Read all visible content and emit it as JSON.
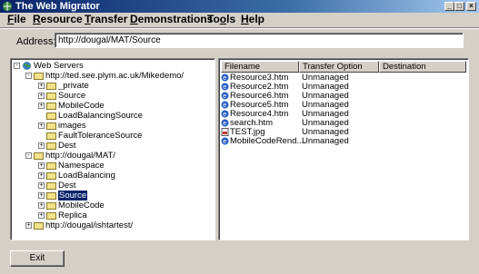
{
  "window": {
    "title": "The Web Migrator"
  },
  "menu": [
    {
      "label": "File"
    },
    {
      "label": "Resource"
    },
    {
      "label": "Transfer"
    },
    {
      "label": "Demonstrations"
    },
    {
      "label": "Tools"
    },
    {
      "label": "Help"
    }
  ],
  "address": {
    "label": "Address:",
    "value": "http://dougal/MAT/Source"
  },
  "tree": {
    "root": "Web Servers",
    "items": [
      {
        "label": "http://ted.see.plym.ac.uk/Mikedemo/",
        "expander": "-"
      },
      {
        "label": "_private",
        "expander": "+"
      },
      {
        "label": "Source",
        "expander": "+"
      },
      {
        "label": "MobileCode",
        "expander": "+"
      },
      {
        "label": "LoadBalancingSource",
        "expander": ""
      },
      {
        "label": "images",
        "expander": "+"
      },
      {
        "label": "FaultToleranceSource",
        "expander": ""
      },
      {
        "label": "Dest",
        "expander": "+"
      },
      {
        "label": "http://dougal/MAT/",
        "expander": "-"
      },
      {
        "label": "Namespace",
        "expander": "+"
      },
      {
        "label": "LoadBalancing",
        "expander": "+"
      },
      {
        "label": "Dest",
        "expander": "+"
      },
      {
        "label": "Source",
        "expander": "+",
        "selected": true
      },
      {
        "label": "MobileCode",
        "expander": "+"
      },
      {
        "label": "Replica",
        "expander": "+"
      },
      {
        "label": "http://dougal/ishtartest/",
        "expander": "+"
      }
    ]
  },
  "list": {
    "columns": [
      "Filename",
      "Transfer Option",
      "Destination"
    ],
    "rows": [
      {
        "filename": "Resource3.htm",
        "option": "Unmanaged",
        "icon": "html-file-icon"
      },
      {
        "filename": "Resource2.htm",
        "option": "Unmanaged",
        "icon": "html-file-icon"
      },
      {
        "filename": "Resource6.htm",
        "option": "Unmanaged",
        "icon": "html-file-icon"
      },
      {
        "filename": "Resource5.htm",
        "option": "Unmanaged",
        "icon": "html-file-icon"
      },
      {
        "filename": "Resource4.htm",
        "option": "Unmanaged",
        "icon": "html-file-icon"
      },
      {
        "filename": "search.htm",
        "option": "Unmanaged",
        "icon": "html-file-icon"
      },
      {
        "filename": "TEST.jpg",
        "option": "Unmanaged",
        "icon": "image-file-icon"
      },
      {
        "filename": "MobileCodeRend...",
        "option": "Unmanaged",
        "icon": "html-file-icon"
      }
    ]
  },
  "buttons": {
    "exit": "Exit"
  }
}
